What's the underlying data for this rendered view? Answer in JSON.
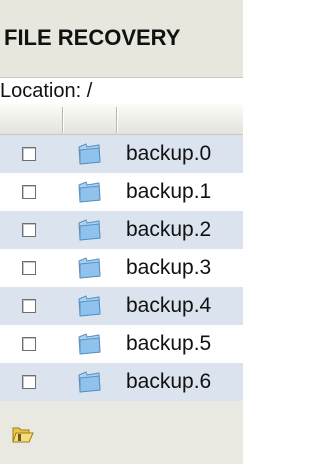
{
  "panel": {
    "title": "FILE RECOVERY",
    "location_label": "Location: /"
  },
  "files": [
    {
      "name": "backup.0",
      "checked": false,
      "icon": "folder-icon"
    },
    {
      "name": "backup.1",
      "checked": false,
      "icon": "folder-icon"
    },
    {
      "name": "backup.2",
      "checked": false,
      "icon": "folder-icon"
    },
    {
      "name": "backup.3",
      "checked": false,
      "icon": "folder-icon"
    },
    {
      "name": "backup.4",
      "checked": false,
      "icon": "folder-icon"
    },
    {
      "name": "backup.5",
      "checked": false,
      "icon": "folder-icon"
    },
    {
      "name": "backup.6",
      "checked": false,
      "icon": "folder-icon"
    }
  ],
  "footer": {
    "icon": "open-folder-icon"
  },
  "colors": {
    "header_bg": "#e7e7de",
    "alt_row_bg": "#dbe3ef",
    "folder_blue": "#8fc3ee",
    "footer_folder": "#e8c64a"
  }
}
